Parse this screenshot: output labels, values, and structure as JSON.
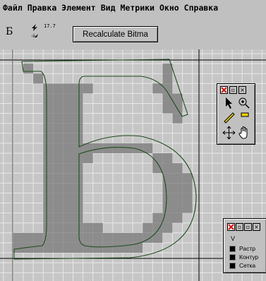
{
  "menu": [
    "Файл",
    "Правка",
    "Элемент",
    "Вид",
    "Метрики",
    "Окно",
    "Справка"
  ],
  "toolbar": {
    "glyph_char": "Б",
    "size_value": "17.7",
    "recalc_label": "Recalculate Bitma"
  },
  "tools_palette": {
    "tools": [
      "pointer-icon",
      "magnify-icon",
      "pencil-icon",
      "ruler-icon",
      "scroll-icon",
      "hand-icon"
    ]
  },
  "layers_palette": {
    "header": "V",
    "layers": [
      "Растр",
      "Контур",
      "Сетка"
    ]
  },
  "colors": {
    "background": "#c6c6c6",
    "grid": "#e8e8e8",
    "raster": "#8c8c8c",
    "outline": "#1d4d1d"
  }
}
